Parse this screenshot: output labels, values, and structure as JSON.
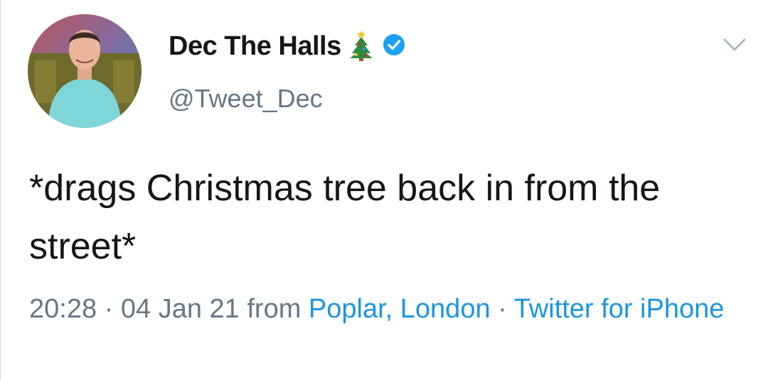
{
  "tweet": {
    "display_name": "Dec The Halls",
    "name_emoji": "christmas-tree-icon",
    "verified": true,
    "handle": "@Tweet_Dec",
    "text": "*drags Christmas tree back in from the street*",
    "time": "20:28",
    "separator": " · ",
    "date": "04 Jan 21",
    "from_label": " from ",
    "location": "Poplar, London",
    "client": "Twitter for iPhone"
  },
  "colors": {
    "name": "#14171a",
    "secondary": "#657786",
    "link": "#1b95e0",
    "verified_badge": "#1da1f2",
    "background": "#ffffff"
  }
}
